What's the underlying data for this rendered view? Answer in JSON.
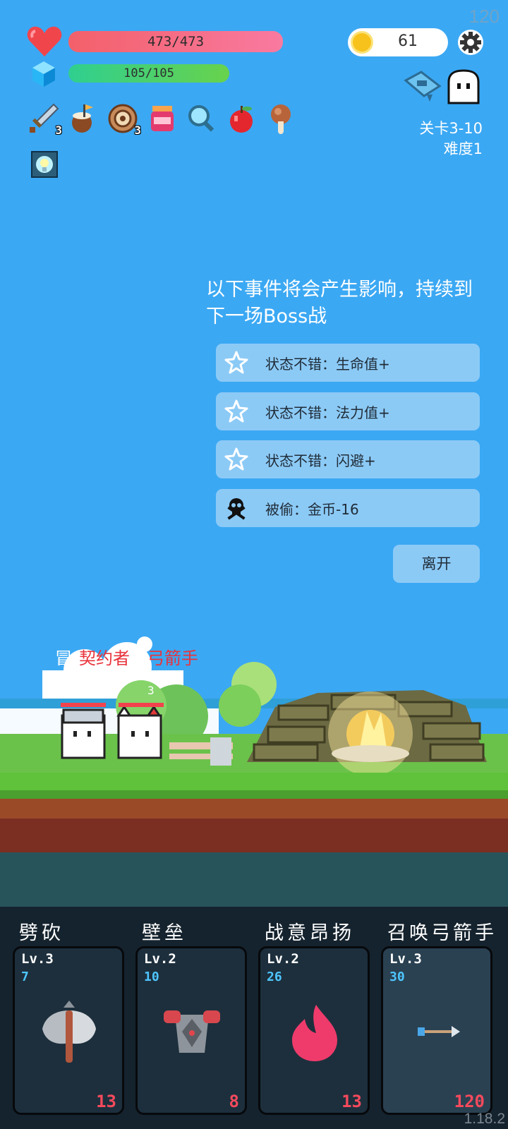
{
  "fps": "120",
  "status": {
    "hp": "473/473",
    "mp": "105/105",
    "coins": "61"
  },
  "stage": {
    "level": "关卡3-10",
    "difficulty": "难度1"
  },
  "inventory": [
    {
      "icon": "sword-icon",
      "count": "3"
    },
    {
      "icon": "coconut-drink-icon",
      "count": ""
    },
    {
      "icon": "shield-ring-icon",
      "count": "3"
    },
    {
      "icon": "jam-jar-icon",
      "count": ""
    },
    {
      "icon": "magnifier-icon",
      "count": ""
    },
    {
      "icon": "apple-icon",
      "count": ""
    },
    {
      "icon": "meat-drumstick-icon",
      "count": ""
    }
  ],
  "event": {
    "title": "以下事件将会产生影响，持续到下一场Boss战",
    "items": [
      {
        "icon": "star-icon",
        "text": "状态不错：生命值+"
      },
      {
        "icon": "star-icon",
        "text": "状态不错：法力值+"
      },
      {
        "icon": "star-icon",
        "text": "状态不错：闪避+"
      },
      {
        "icon": "skull-icon",
        "text": "被偷：金币-16"
      }
    ],
    "leave_label": "离开"
  },
  "party": {
    "label_prefix": "冒",
    "names": [
      "契约者",
      "弓箭手"
    ],
    "floating_num": "3"
  },
  "skills": [
    {
      "name": "劈砍",
      "level": "Lv.3",
      "cost": "7",
      "value": "13",
      "icon": "axe-icon"
    },
    {
      "name": "壁垒",
      "level": "Lv.2",
      "cost": "10",
      "value": "8",
      "icon": "armor-icon"
    },
    {
      "name": "战意昂扬",
      "level": "Lv.2",
      "cost": "26",
      "value": "13",
      "icon": "flame-icon"
    },
    {
      "name": "召唤弓箭手",
      "level": "Lv.3",
      "cost": "30",
      "value": "120",
      "icon": "arrow-icon"
    }
  ],
  "version": "1.18.2",
  "colors": {
    "sky": "#3ba8f3",
    "hp": "#f3606a",
    "mp": "#2fcf90",
    "card_bg": "#1d2f3d",
    "damage": "#f44a5c",
    "cost": "#4ec6ff"
  }
}
